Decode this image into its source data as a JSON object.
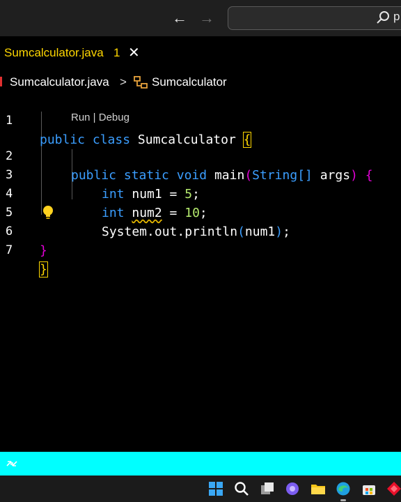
{
  "titlebar": {
    "search_text": "p"
  },
  "tab": {
    "title": "Sumcalculator.java",
    "problems_count": "1",
    "close_glyph": "✕"
  },
  "breadcrumb": {
    "file": "Sumcalculator.java",
    "separator": ">",
    "class_name": "Sumcalculator"
  },
  "editor": {
    "codelens": "Run | Debug",
    "line_numbers": [
      "1",
      "2",
      "3",
      "4",
      "5",
      "6",
      "7"
    ],
    "lines": {
      "l1": {
        "kw1": "public",
        "kw2": "class",
        "name": "Sumcalculator",
        "brace": "{"
      },
      "l2": {
        "kw1": "public",
        "kw2": "static",
        "kw3": "void",
        "name": "main",
        "open": "(",
        "type": "String",
        "arr": "[]",
        "param": "args",
        "close": ")",
        "brace": "{"
      },
      "l3": {
        "kw": "int",
        "var": "num1",
        "eq": " = ",
        "val": "5",
        "semi": ";"
      },
      "l4": {
        "kw": "int",
        "var": "num2",
        "eq": " = ",
        "val": "10",
        "semi": ";"
      },
      "l5": {
        "call": "System.out.println",
        "open": "(",
        "arg": "num1",
        "close": ")",
        "semi": ";"
      },
      "l6": {
        "brace": "}"
      },
      "l7": {
        "brace": "}"
      }
    }
  },
  "icons": {
    "back": "arrow-left-icon",
    "forward": "arrow-right-icon",
    "search": "search-icon",
    "close": "close-icon",
    "class": "class-symbol-icon",
    "lightbulb": "lightbulb-icon",
    "remote": "remote-icon"
  },
  "taskbar_icons": [
    "windows-start-icon",
    "search-icon",
    "task-view-icon",
    "chat-icon",
    "file-explorer-icon",
    "edge-icon",
    "store-icon",
    "app-icon"
  ],
  "colors": {
    "keyword": "#3b9eff",
    "tab_title": "#ffd700",
    "statusbar": "#00ffff",
    "number": "#b5ea6e",
    "bracket_pink": "#e400d8"
  }
}
